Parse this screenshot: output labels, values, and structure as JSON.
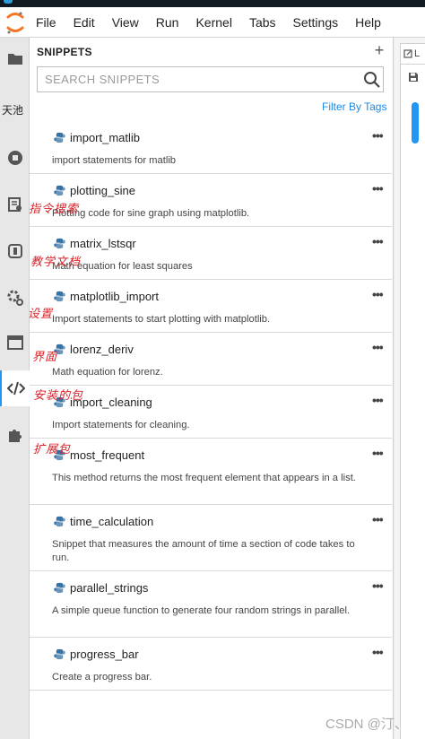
{
  "menubar": {
    "items": [
      "File",
      "Edit",
      "View",
      "Run",
      "Kernel",
      "Tabs",
      "Settings",
      "Help"
    ]
  },
  "activity_bar": {
    "tianchi_label": "天池"
  },
  "snippets_panel": {
    "title": "SNIPPETS",
    "add_label": "+",
    "search_placeholder": "SEARCH SNIPPETS",
    "filter_label": "Filter By Tags",
    "more_label": "•••",
    "snippets": [
      {
        "name": "import_matlib",
        "description": "import statements for matlib"
      },
      {
        "name": "plotting_sine",
        "description": "Plotting code for sine graph using matplotlib."
      },
      {
        "name": "matrix_lstsqr",
        "description": "Math equation for least squares"
      },
      {
        "name": "matplotlib_import",
        "description": "Import statements to start plotting with matplotlib."
      },
      {
        "name": "lorenz_deriv",
        "description": "Math equation for lorenz."
      },
      {
        "name": "import_cleaning",
        "description": "Import statements for cleaning."
      },
      {
        "name": "most_frequent",
        "description": "This method returns the most frequent element that appears in a list."
      },
      {
        "name": "time_calculation",
        "description": "Snippet that measures the amount of time a section of code takes to run."
      },
      {
        "name": "parallel_strings",
        "description": "A simple queue function to generate four random strings in parallel."
      },
      {
        "name": "progress_bar",
        "description": "Create a progress bar."
      }
    ]
  },
  "annotations": {
    "commands": "指令搜索",
    "docs": "教学文档",
    "settings": "设置",
    "interface": "界面",
    "packages": "安装的包",
    "extensions": "扩展包"
  },
  "right_panel": {
    "tab_letter": "L"
  },
  "watermark": "CSDN @汀、",
  "colors": {
    "accent": "#2196f3",
    "annotation": "#d8232a",
    "jupyter_orange": "#f37726"
  }
}
